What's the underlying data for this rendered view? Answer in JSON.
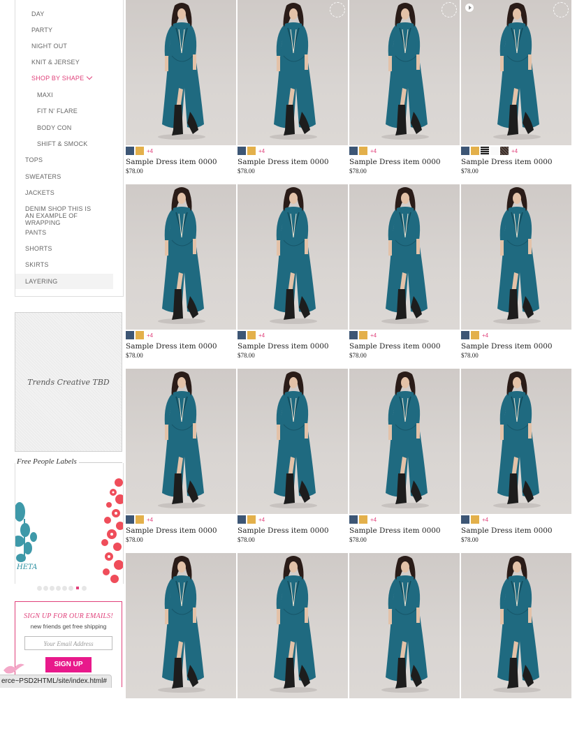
{
  "sidebar": {
    "nav": [
      {
        "label": "DAY",
        "level": 1
      },
      {
        "label": "PARTY",
        "level": 1
      },
      {
        "label": "NIGHT OUT",
        "level": 1
      },
      {
        "label": "KNIT & JERSEY",
        "level": 1
      },
      {
        "label": "SHOP BY SHAPE",
        "level": 1,
        "active": true,
        "expanded": true
      },
      {
        "label": "MAXI",
        "level": 2
      },
      {
        "label": "FIT N' FLARE",
        "level": 2
      },
      {
        "label": "BODY CON",
        "level": 2
      },
      {
        "label": "SHIFT & SMOCK",
        "level": 2
      },
      {
        "label": "TOPS",
        "level": 0
      },
      {
        "label": "SWEATERS",
        "level": 0
      },
      {
        "label": "JACKETS",
        "level": 0
      },
      {
        "label": "DENIM SHOP THIS IS AN EXAMPLE OF WRAPPING",
        "level": 0
      },
      {
        "label": "PANTS",
        "level": 0
      },
      {
        "label": "SHORTS",
        "level": 0
      },
      {
        "label": "SKIRTS",
        "level": 0
      },
      {
        "label": "LAYERING",
        "level": 0,
        "selected": true
      }
    ],
    "trends_text": "Trends Creative TBD",
    "labels_title": "Free People Labels",
    "labels_logo_text": "HETA",
    "carousel_dot_count": 7,
    "carousel_active_dot": 5,
    "signup": {
      "title": "SIGN UP FOR OUR EMAILS!",
      "subtitle": "new friends get free shipping",
      "placeholder": "Your Email Address",
      "button": "SIGN UP"
    }
  },
  "status_url": "erce~PSD2HTML/site/index.html#",
  "colors": {
    "accent": "#e0407a",
    "signup_button": "#e8198b",
    "swatch_blue": "#3d5675",
    "swatch_gold": "#e3b04b",
    "dress": "#1f6a80"
  },
  "products": [
    {
      "name": "Sample Dress item 0000",
      "price": "$78.00",
      "swatches": [
        "blue",
        "gold"
      ],
      "more": "+4",
      "badge": false,
      "play": false
    },
    {
      "name": "Sample Dress item 0000",
      "price": "$78.00",
      "swatches": [
        "blue",
        "gold"
      ],
      "more": "+4",
      "badge": true,
      "play": false
    },
    {
      "name": "Sample Dress item 0000",
      "price": "$78.00",
      "swatches": [
        "blue",
        "gold"
      ],
      "more": "+4",
      "badge": true,
      "play": false
    },
    {
      "name": "Sample Dress item 0000",
      "price": "$78.00",
      "swatches": [
        "blue",
        "gold",
        "stripe",
        "white",
        "pattern"
      ],
      "more": "+4",
      "badge": true,
      "play": true
    },
    {
      "name": "Sample Dress item 0000",
      "price": "$78.00",
      "swatches": [
        "blue",
        "gold"
      ],
      "more": "+4",
      "badge": false,
      "play": false
    },
    {
      "name": "Sample Dress item 0000",
      "price": "$78.00",
      "swatches": [
        "blue",
        "gold"
      ],
      "more": "+4",
      "badge": false,
      "play": false
    },
    {
      "name": "Sample Dress item 0000",
      "price": "$78.00",
      "swatches": [
        "blue",
        "gold"
      ],
      "more": "+4",
      "badge": false,
      "play": false
    },
    {
      "name": "Sample Dress item 0000",
      "price": "$78.00",
      "swatches": [
        "blue",
        "gold"
      ],
      "more": "+4",
      "badge": false,
      "play": false
    },
    {
      "name": "Sample Dress item 0000",
      "price": "$78.00",
      "swatches": [
        "blue",
        "gold"
      ],
      "more": "+4",
      "badge": false,
      "play": false
    },
    {
      "name": "Sample Dress item 0000",
      "price": "$78.00",
      "swatches": [
        "blue",
        "gold"
      ],
      "more": "+4",
      "badge": false,
      "play": false
    },
    {
      "name": "Sample Dress item 0000",
      "price": "$78.00",
      "swatches": [
        "blue",
        "gold"
      ],
      "more": "+4",
      "badge": false,
      "play": false
    },
    {
      "name": "Sample Dress item 0000",
      "price": "$78.00",
      "swatches": [
        "blue",
        "gold"
      ],
      "more": "+4",
      "badge": false,
      "play": false
    },
    {
      "name": "",
      "price": "",
      "swatches": [],
      "more": "",
      "badge": false,
      "play": false
    },
    {
      "name": "",
      "price": "",
      "swatches": [],
      "more": "",
      "badge": false,
      "play": false
    },
    {
      "name": "",
      "price": "",
      "swatches": [],
      "more": "",
      "badge": false,
      "play": false
    },
    {
      "name": "",
      "price": "",
      "swatches": [],
      "more": "",
      "badge": false,
      "play": false
    }
  ]
}
